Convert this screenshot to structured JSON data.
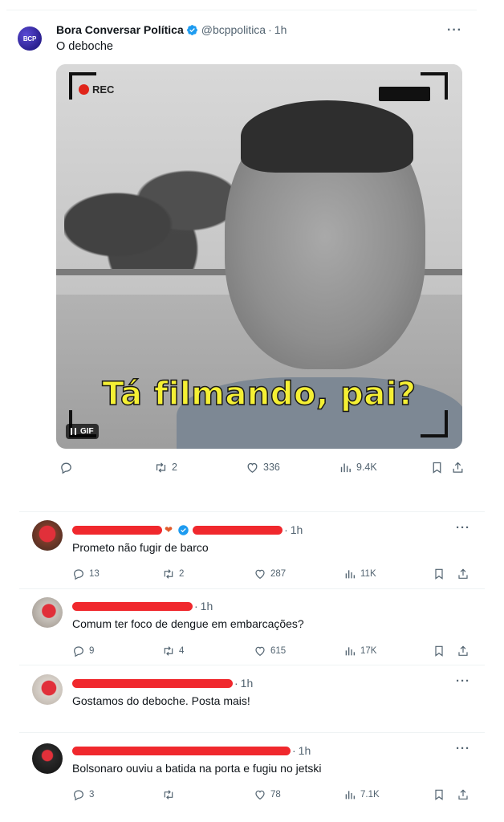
{
  "main_tweet": {
    "avatar_text": "BCP",
    "name": "Bora Conversar Política",
    "handle": "@bcppolitica",
    "separator": "·",
    "time": "1h",
    "text": "O deboche",
    "media": {
      "rec_label": "REC",
      "caption": "Tá filmando, pai?",
      "badge": "GIF"
    },
    "actions": {
      "reply": "",
      "retweets": "2",
      "likes": "336",
      "views": "9.4K"
    },
    "more": "···"
  },
  "replies": [
    {
      "separator": "·",
      "time": "1h",
      "text": "Prometo não fugir de barco",
      "replies": "13",
      "retweets": "2",
      "likes": "287",
      "views": "11K",
      "more": "···"
    },
    {
      "separator": "·",
      "time": "1h",
      "text": "Comum ter foco de dengue em embarcações?",
      "replies": "9",
      "retweets": "4",
      "likes": "615",
      "views": "17K",
      "more": "···"
    },
    {
      "separator": "·",
      "time": "1h",
      "text": "Gostamos do deboche. Posta mais!",
      "more": "···"
    },
    {
      "separator": "·",
      "time": "1h",
      "text": "Bolsonaro ouviu a batida na porta e fugiu no jetski",
      "replies": "3",
      "retweets": "",
      "likes": "78",
      "views": "7.1K",
      "more": "···"
    }
  ],
  "colors": {
    "text_primary": "#0f1419",
    "text_secondary": "#536471",
    "verified_blue": "#1d9bf0",
    "redaction_red": "#f0282d",
    "caption_yellow": "#f5f034"
  },
  "icons": [
    "reply-icon",
    "retweet-icon",
    "like-icon",
    "views-icon",
    "bookmark-icon",
    "share-icon",
    "verified-badge-icon",
    "more-icon"
  ]
}
